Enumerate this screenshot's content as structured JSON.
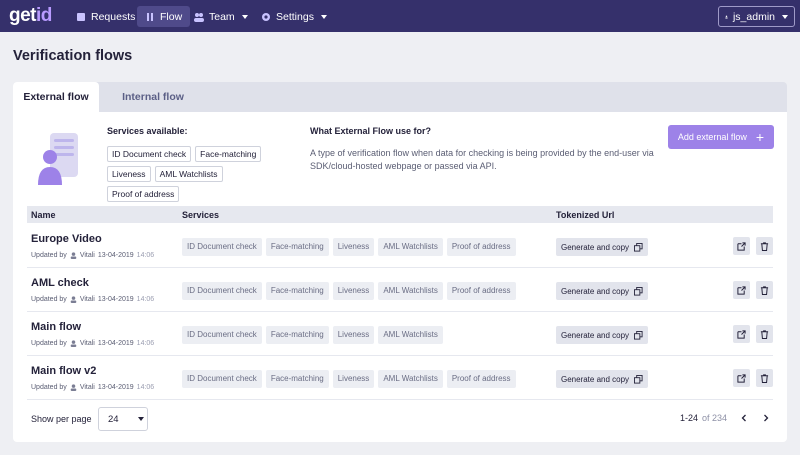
{
  "nav": {
    "logo_main": "get",
    "logo_accent": "id",
    "items": [
      {
        "label": "Requests",
        "icon": "list-icon"
      },
      {
        "label": "Flow",
        "icon": "flow-icon"
      },
      {
        "label": "Team",
        "icon": "team-icon"
      },
      {
        "label": "Settings",
        "icon": "gear-icon"
      }
    ],
    "user": "js_admin"
  },
  "page": {
    "title": "Verification flows",
    "tabs": [
      "External flow",
      "Internal flow"
    ],
    "services_title": "Services available:",
    "services": [
      "ID Document check",
      "Face-matching",
      "Liveness",
      "AML Watchlists",
      "Proof of address"
    ],
    "why_title": "What External Flow use for?",
    "why_text": "A type of verification flow when data for checking is being provided by the end-user via SDK/cloud-hosted webpage or passed via API.",
    "add_button": "Add external flow",
    "accent_color": "#9d82e8",
    "nav_color": "#35306b"
  },
  "table": {
    "headers": [
      "Name",
      "Services",
      "Tokenized Url"
    ],
    "updated_by_label": "Updated by",
    "generate_label": "Generate and copy",
    "rows": [
      {
        "name": "Europe Video",
        "user": "Vitali",
        "date": "13-04-2019",
        "time": "14:06",
        "services": [
          "ID Document check",
          "Face-matching",
          "Liveness",
          "AML Watchlists",
          "Proof of address"
        ]
      },
      {
        "name": "AML check",
        "user": "Vitali",
        "date": "13-04-2019",
        "time": "14:06",
        "services": [
          "ID Document check",
          "Face-matching",
          "Liveness",
          "AML Watchlists",
          "Proof of address"
        ]
      },
      {
        "name": "Main flow",
        "user": "Vitali",
        "date": "13-04-2019",
        "time": "14:06",
        "services": [
          "ID Document check",
          "Face-matching",
          "Liveness",
          "AML Watchlists"
        ]
      },
      {
        "name": "Main flow v2",
        "user": "Vitali",
        "date": "13-04-2019",
        "time": "14:06",
        "services": [
          "ID Document check",
          "Face-matching",
          "Liveness",
          "AML Watchlists",
          "Proof of address"
        ]
      }
    ]
  },
  "footer": {
    "per_page_label": "Show per page",
    "per_page_value": "24",
    "range": "1-24",
    "of_label": "of 234"
  }
}
